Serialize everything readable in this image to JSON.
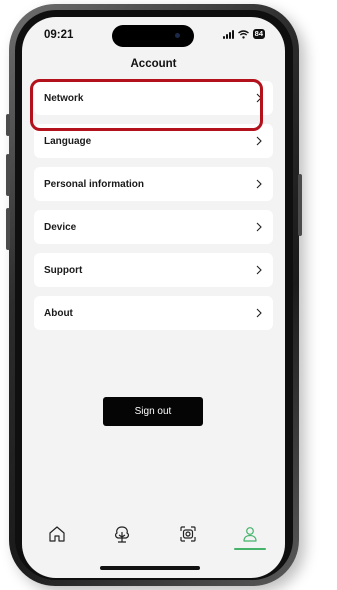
{
  "status_bar": {
    "time": "09:21",
    "battery": "84",
    "icons": [
      "signal-icon",
      "wifi-icon",
      "battery-icon"
    ]
  },
  "header": {
    "title": "Account"
  },
  "menu": {
    "items": [
      {
        "label": "Network",
        "icon": "chevron-right-icon"
      },
      {
        "label": "Language",
        "icon": "chevron-right-icon"
      },
      {
        "label": "Personal information",
        "icon": "chevron-right-icon"
      },
      {
        "label": "Device",
        "icon": "chevron-right-icon"
      },
      {
        "label": "Support",
        "icon": "chevron-right-icon"
      },
      {
        "label": "About",
        "icon": "chevron-right-icon"
      }
    ]
  },
  "actions": {
    "sign_out_label": "Sign out"
  },
  "tab_bar": {
    "tabs": [
      {
        "icon": "home-icon"
      },
      {
        "icon": "tree-icon"
      },
      {
        "icon": "camera-icon"
      },
      {
        "icon": "user-icon",
        "active": true
      }
    ]
  },
  "colors": {
    "highlight": "#b3121d",
    "active_tab": "#46b36a",
    "background": "#f3f3f3",
    "button": "#050505"
  }
}
